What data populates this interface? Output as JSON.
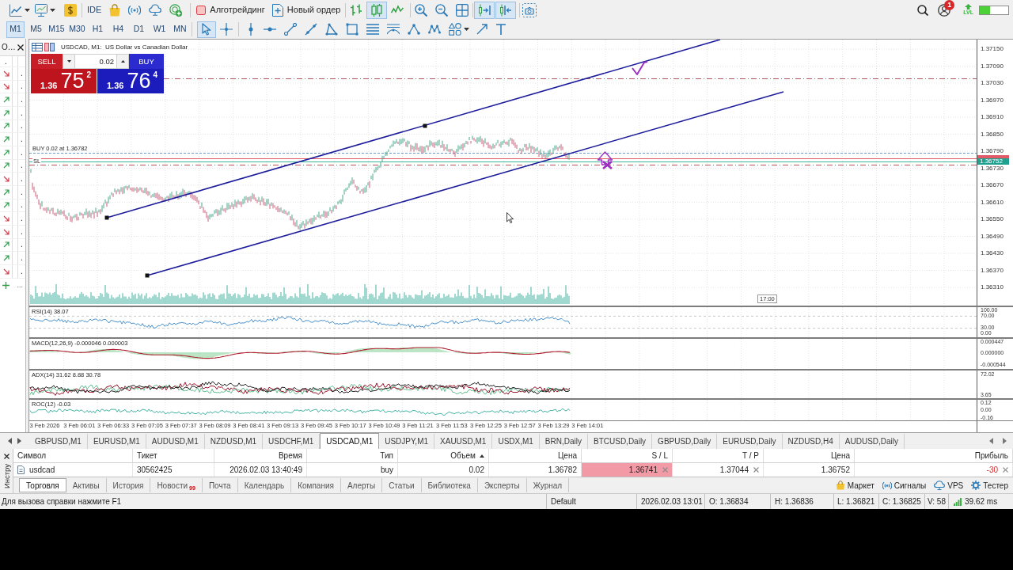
{
  "toolbar": {
    "ide_label": "IDE",
    "algo_trading": {
      "label": "Алготрейдинг",
      "on": false
    },
    "new_order": {
      "label": "Новый ордер"
    },
    "chart_types": [
      {
        "kind": "bars",
        "selected": false
      },
      {
        "kind": "candles",
        "selected": true
      },
      {
        "kind": "line",
        "selected": false
      }
    ],
    "chart_toggles": [
      {
        "kind": "autoscroll",
        "on": true
      },
      {
        "kind": "shift",
        "on": true
      }
    ],
    "notifications": "1",
    "level_label": "LVL",
    "level_meter": {
      "level": 0.35
    }
  },
  "timeframes": [
    {
      "label": "M1",
      "selected": true
    },
    {
      "label": "M5",
      "selected": false
    },
    {
      "label": "M15",
      "selected": false
    },
    {
      "label": "M30",
      "selected": false
    },
    {
      "label": "H1",
      "selected": false
    },
    {
      "label": "H4",
      "selected": false
    },
    {
      "label": "D1",
      "selected": false
    },
    {
      "label": "W1",
      "selected": false
    },
    {
      "label": "MN",
      "selected": false
    }
  ],
  "cursor_tools": [
    {
      "kind": "cursor",
      "selected": true
    },
    {
      "kind": "crosshair",
      "selected": false
    }
  ],
  "market_watch": {
    "title": "O…",
    "rows": [
      {
        "kind": "plain",
        "text": "."
      },
      {
        "kind": "down",
        "text": "."
      },
      {
        "kind": "down",
        "text": "."
      },
      {
        "kind": "up",
        "text": "."
      },
      {
        "kind": "up",
        "text": "."
      },
      {
        "kind": "up",
        "text": "."
      },
      {
        "kind": "up",
        "text": "."
      },
      {
        "kind": "up",
        "text": "."
      },
      {
        "kind": "up",
        "text": "."
      },
      {
        "kind": "down",
        "text": "."
      },
      {
        "kind": "up",
        "text": "."
      },
      {
        "kind": "up",
        "text": "."
      },
      {
        "kind": "down",
        "text": "."
      },
      {
        "kind": "down",
        "text": "."
      },
      {
        "kind": "up",
        "text": "."
      },
      {
        "kind": "up",
        "text": "."
      },
      {
        "kind": "down",
        "text": "."
      }
    ],
    "more": "..."
  },
  "chart": {
    "title": "USDCAD, M1:  US Dollar vs Canadian Dollar",
    "one_click": {
      "sell_label": "SELL",
      "buy_label": "BUY",
      "volume": "0.02",
      "sell": {
        "base": "1.36",
        "pips": "75",
        "point": "2"
      },
      "buy": {
        "base": "1.36",
        "pips": "76",
        "point": "4"
      }
    },
    "order_label": "BUY 0.02 at 1.36782",
    "sl_label": "SL",
    "price_labels": [
      "1.37150",
      "1.37090",
      "1.37030",
      "1.36970",
      "1.36910",
      "1.36850",
      "1.36790",
      "1.36730",
      "1.36670",
      "1.36610",
      "1.36550",
      "1.36490",
      "1.36430",
      "1.36370",
      "1.36310"
    ],
    "bid_tag": "1.36752",
    "time_marker": "17:00"
  },
  "indicators": [
    {
      "kind": "rsi",
      "label": "RSI(14) 38.07",
      "axis_labels": [
        "100.00",
        "70.00",
        "30.00",
        "0.00"
      ]
    },
    {
      "kind": "macd",
      "label": "MACD(12,26,9) -0.000046 0.000003",
      "axis_labels": [
        "0.000447",
        "0.000000",
        "-0.000544"
      ]
    },
    {
      "kind": "adx",
      "label": "ADX(14) 31.62 8.88 30.78",
      "axis_labels": [
        "72.02",
        "3.65"
      ]
    },
    {
      "kind": "roc",
      "label": "ROC(12) -0.03",
      "axis_labels": [
        "0.12",
        "0.00",
        "-0.16"
      ]
    }
  ],
  "time_labels": [
    "3 Feb 2026",
    "3 Feb 06:01",
    "3 Feb 06:33",
    "3 Feb 07:05",
    "3 Feb 07:37",
    "3 Feb 08:09",
    "3 Feb 08:41",
    "3 Feb 09:13",
    "3 Feb 09:45",
    "3 Feb 10:17",
    "3 Feb 10:49",
    "3 Feb 11:21",
    "3 Feb 11:53",
    "3 Feb 12:25",
    "3 Feb 12:57",
    "3 Feb 13:29",
    "3 Feb 14:01"
  ],
  "chart_tabs": [
    {
      "label": "GBPUSD,M1",
      "selected": false
    },
    {
      "label": "EURUSD,M1",
      "selected": false
    },
    {
      "label": "AUDUSD,M1",
      "selected": false
    },
    {
      "label": "NZDUSD,M1",
      "selected": false
    },
    {
      "label": "USDCHF,M1",
      "selected": false
    },
    {
      "label": "USDCAD,M1",
      "selected": true
    },
    {
      "label": "USDJPY,M1",
      "selected": false
    },
    {
      "label": "XAUUSD,M1",
      "selected": false
    },
    {
      "label": "USDX,M1",
      "selected": false
    },
    {
      "label": "BRN,Daily",
      "selected": false
    },
    {
      "label": "BTCUSD,Daily",
      "selected": false
    },
    {
      "label": "GBPUSD,Daily",
      "selected": false
    },
    {
      "label": "EURUSD,Daily",
      "selected": false
    },
    {
      "label": "NZDUSD,H4",
      "selected": false
    },
    {
      "label": "AUDUSD,Daily",
      "selected": false
    }
  ],
  "toolbox": {
    "side_label": "Инстру",
    "columns": [
      {
        "label": "Символ",
        "sorted": false
      },
      {
        "label": "Тикет",
        "sorted": false
      },
      {
        "label": "Время",
        "sorted": false
      },
      {
        "label": "Тип",
        "sorted": false
      },
      {
        "label": "Объем",
        "sorted": true
      },
      {
        "label": "Цена",
        "sorted": false
      },
      {
        "label": "S / L",
        "sorted": false
      },
      {
        "label": "T / P",
        "sorted": false
      },
      {
        "label": "Цена",
        "sorted": false
      },
      {
        "label": "Прибыль",
        "sorted": false
      }
    ],
    "rows": [
      {
        "symbol": "usdcad",
        "ticket": "30562425",
        "time": "2026.02.03 13:40:49",
        "type": "buy",
        "volume": "0.02",
        "price": "1.36782",
        "sl": "1.36741",
        "sl_highlighted": true,
        "tp": "1.37044",
        "current_price": "1.36752",
        "profit": "-30",
        "loss": true
      }
    ],
    "tabs": [
      {
        "label": "Торговля",
        "selected": true
      },
      {
        "label": "Активы",
        "selected": false
      },
      {
        "label": "История",
        "selected": false
      },
      {
        "label": "Новости",
        "selected": false,
        "badge": "99"
      },
      {
        "label": "Почта",
        "selected": false
      },
      {
        "label": "Календарь",
        "selected": false
      },
      {
        "label": "Компания",
        "selected": false
      },
      {
        "label": "Алерты",
        "selected": false
      },
      {
        "label": "Статьи",
        "selected": false
      },
      {
        "label": "Библиотека",
        "selected": false
      },
      {
        "label": "Эксперты",
        "selected": false
      },
      {
        "label": "Журнал",
        "selected": false
      }
    ],
    "links": [
      {
        "kind": "market",
        "label": "Маркет"
      },
      {
        "kind": "signals",
        "label": "Сигналы"
      },
      {
        "kind": "vps",
        "label": "VPS"
      },
      {
        "kind": "tester",
        "label": "Тестер"
      }
    ]
  },
  "status_bar": {
    "help": "Для вызова справки нажмите F1",
    "profile": "Default",
    "datetime": "2026.02.03 13:01",
    "open": "O: 1.36834",
    "high": "H: 1.36836",
    "low": "L: 1.36821",
    "close": "C: 1.36825",
    "volume": "V: 58",
    "ping": "39.62 ms"
  }
}
